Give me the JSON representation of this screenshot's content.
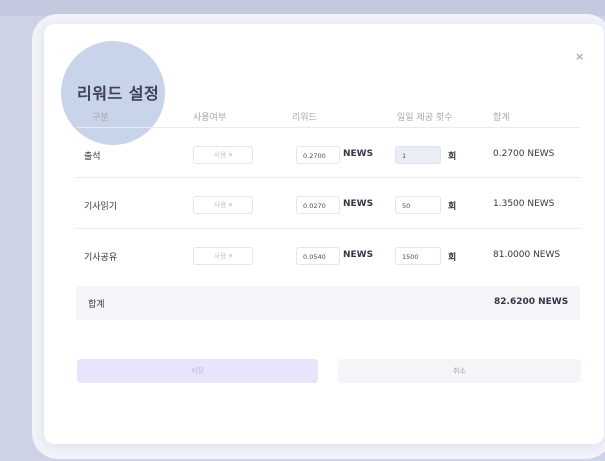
{
  "modal": {
    "title": "리워드 설정",
    "close_label": "×"
  },
  "table": {
    "headers": [
      "구분",
      "사용여부",
      "리워드",
      "일일 제공 횟수",
      "합계"
    ],
    "rows": [
      {
        "name": "출석",
        "use": "사용 ▾",
        "reward": "0.2700",
        "reward_unit": "NEWS",
        "count": "1",
        "count_unit": "회",
        "total": "0.2700 NEWS"
      },
      {
        "name": "기사읽기",
        "use": "사용 ▾",
        "reward": "0.0270",
        "reward_unit": "NEWS",
        "count": "50",
        "count_unit": "회",
        "total": "1.3500 NEWS"
      },
      {
        "name": "기사공유",
        "use": "사용 ▾",
        "reward": "0.0540",
        "reward_unit": "NEWS",
        "count": "1500",
        "count_unit": "회",
        "total": "81.0000 NEWS"
      }
    ],
    "summary": {
      "label": "합계",
      "total": "82.6200 NEWS"
    }
  },
  "buttons": {
    "save_label": "저장",
    "cancel_label": "취소"
  },
  "colors": {
    "accent_light": "#e6e5fb",
    "highlight_circle": "#c8d4ea",
    "background": "#cdd2e6"
  }
}
